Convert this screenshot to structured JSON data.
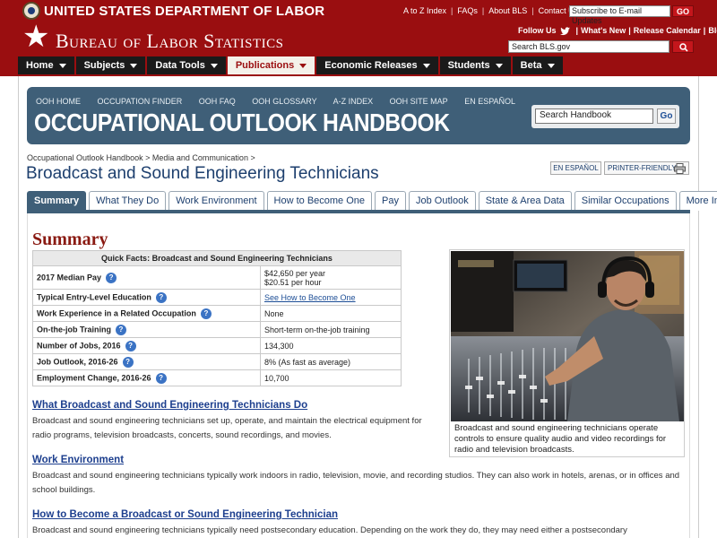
{
  "header": {
    "dol_title": "UNITED STATES DEPARTMENT OF LABOR",
    "top_links": [
      "A to Z Index",
      "FAQs",
      "About BLS",
      "Contact Us"
    ],
    "subscribe_placeholder": "Subscribe to E-mail Updates",
    "go_label": "GO",
    "bls_title": "Bureau of Labor Statistics",
    "util_links": {
      "follow": "Follow Us",
      "whats_new": "What's New",
      "release_calendar": "Release Calendar",
      "blog": "Blog"
    },
    "search_placeholder": "Search BLS.gov"
  },
  "nav": [
    {
      "label": "Home"
    },
    {
      "label": "Subjects"
    },
    {
      "label": "Data Tools"
    },
    {
      "label": "Publications"
    },
    {
      "label": "Economic Releases"
    },
    {
      "label": "Students"
    },
    {
      "label": "Beta"
    }
  ],
  "ooh": {
    "links": [
      "OOH HOME",
      "OCCUPATION FINDER",
      "OOH FAQ",
      "OOH GLOSSARY",
      "A-Z INDEX",
      "OOH SITE MAP",
      "EN ESPAÑOL"
    ],
    "title": "OCCUPATIONAL OUTLOOK HANDBOOK",
    "search_value": "Search Handbook",
    "go_label": "Go"
  },
  "breadcrumb": {
    "item1": "Occupational Outlook Handbook",
    "sep": ">",
    "item2": "Media and Communication"
  },
  "page_title": "Broadcast and Sound Engineering Technicians",
  "espanol_label": "EN ESPAÑOL",
  "printer_label": "PRINTER-FRIENDLY",
  "tabs": [
    {
      "label": "Summary"
    },
    {
      "label": "What They Do"
    },
    {
      "label": "Work Environment"
    },
    {
      "label": "How to Become One"
    },
    {
      "label": "Pay"
    },
    {
      "label": "Job Outlook"
    },
    {
      "label": "State & Area Data"
    },
    {
      "label": "Similar Occupations"
    },
    {
      "label": "More Info"
    }
  ],
  "summary": {
    "heading": "Summary",
    "quick_facts_title": "Quick Facts: Broadcast and Sound Engineering Technicians",
    "facts": [
      {
        "label": "2017 Median Pay",
        "value": "$42,650 per year",
        "value2": "$20.51 per hour"
      },
      {
        "label": "Typical Entry-Level Education",
        "value": "See How to Become One"
      },
      {
        "label": "Work Experience in a Related Occupation",
        "value": "None"
      },
      {
        "label": "On-the-job Training",
        "value": "Short-term on-the-job training"
      },
      {
        "label": "Number of Jobs, 2016",
        "value": "134,300"
      },
      {
        "label": "Job Outlook, 2016-26",
        "value": "8% (As fast as average)"
      },
      {
        "label": "Employment Change, 2016-26",
        "value": "10,700"
      }
    ],
    "photo_caption": "Broadcast and sound engineering technicians operate controls to ensure quality audio and video recordings for radio and television broadcasts.",
    "sections": [
      {
        "heading": "What Broadcast and Sound Engineering Technicians Do",
        "text": "Broadcast and sound engineering technicians set up, operate, and maintain the electrical equipment for radio programs, television broadcasts, concerts, sound recordings, and movies."
      },
      {
        "heading": "Work Environment",
        "text": "Broadcast and sound engineering technicians typically work indoors in radio, television, movie, and recording studios. They can also work in hotels, arenas, or in offices and school buildings."
      },
      {
        "heading": "How to Become a Broadcast or Sound Engineering Technician",
        "text": "Broadcast and sound engineering technicians typically need postsecondary education. Depending on the work they do, they may need either a postsecondary"
      }
    ]
  },
  "colors": {
    "header_red": "#9a0e10",
    "ooh_blue": "#3f5f78",
    "link_blue": "#1d3f8e",
    "summary_red": "#8a1a12"
  }
}
